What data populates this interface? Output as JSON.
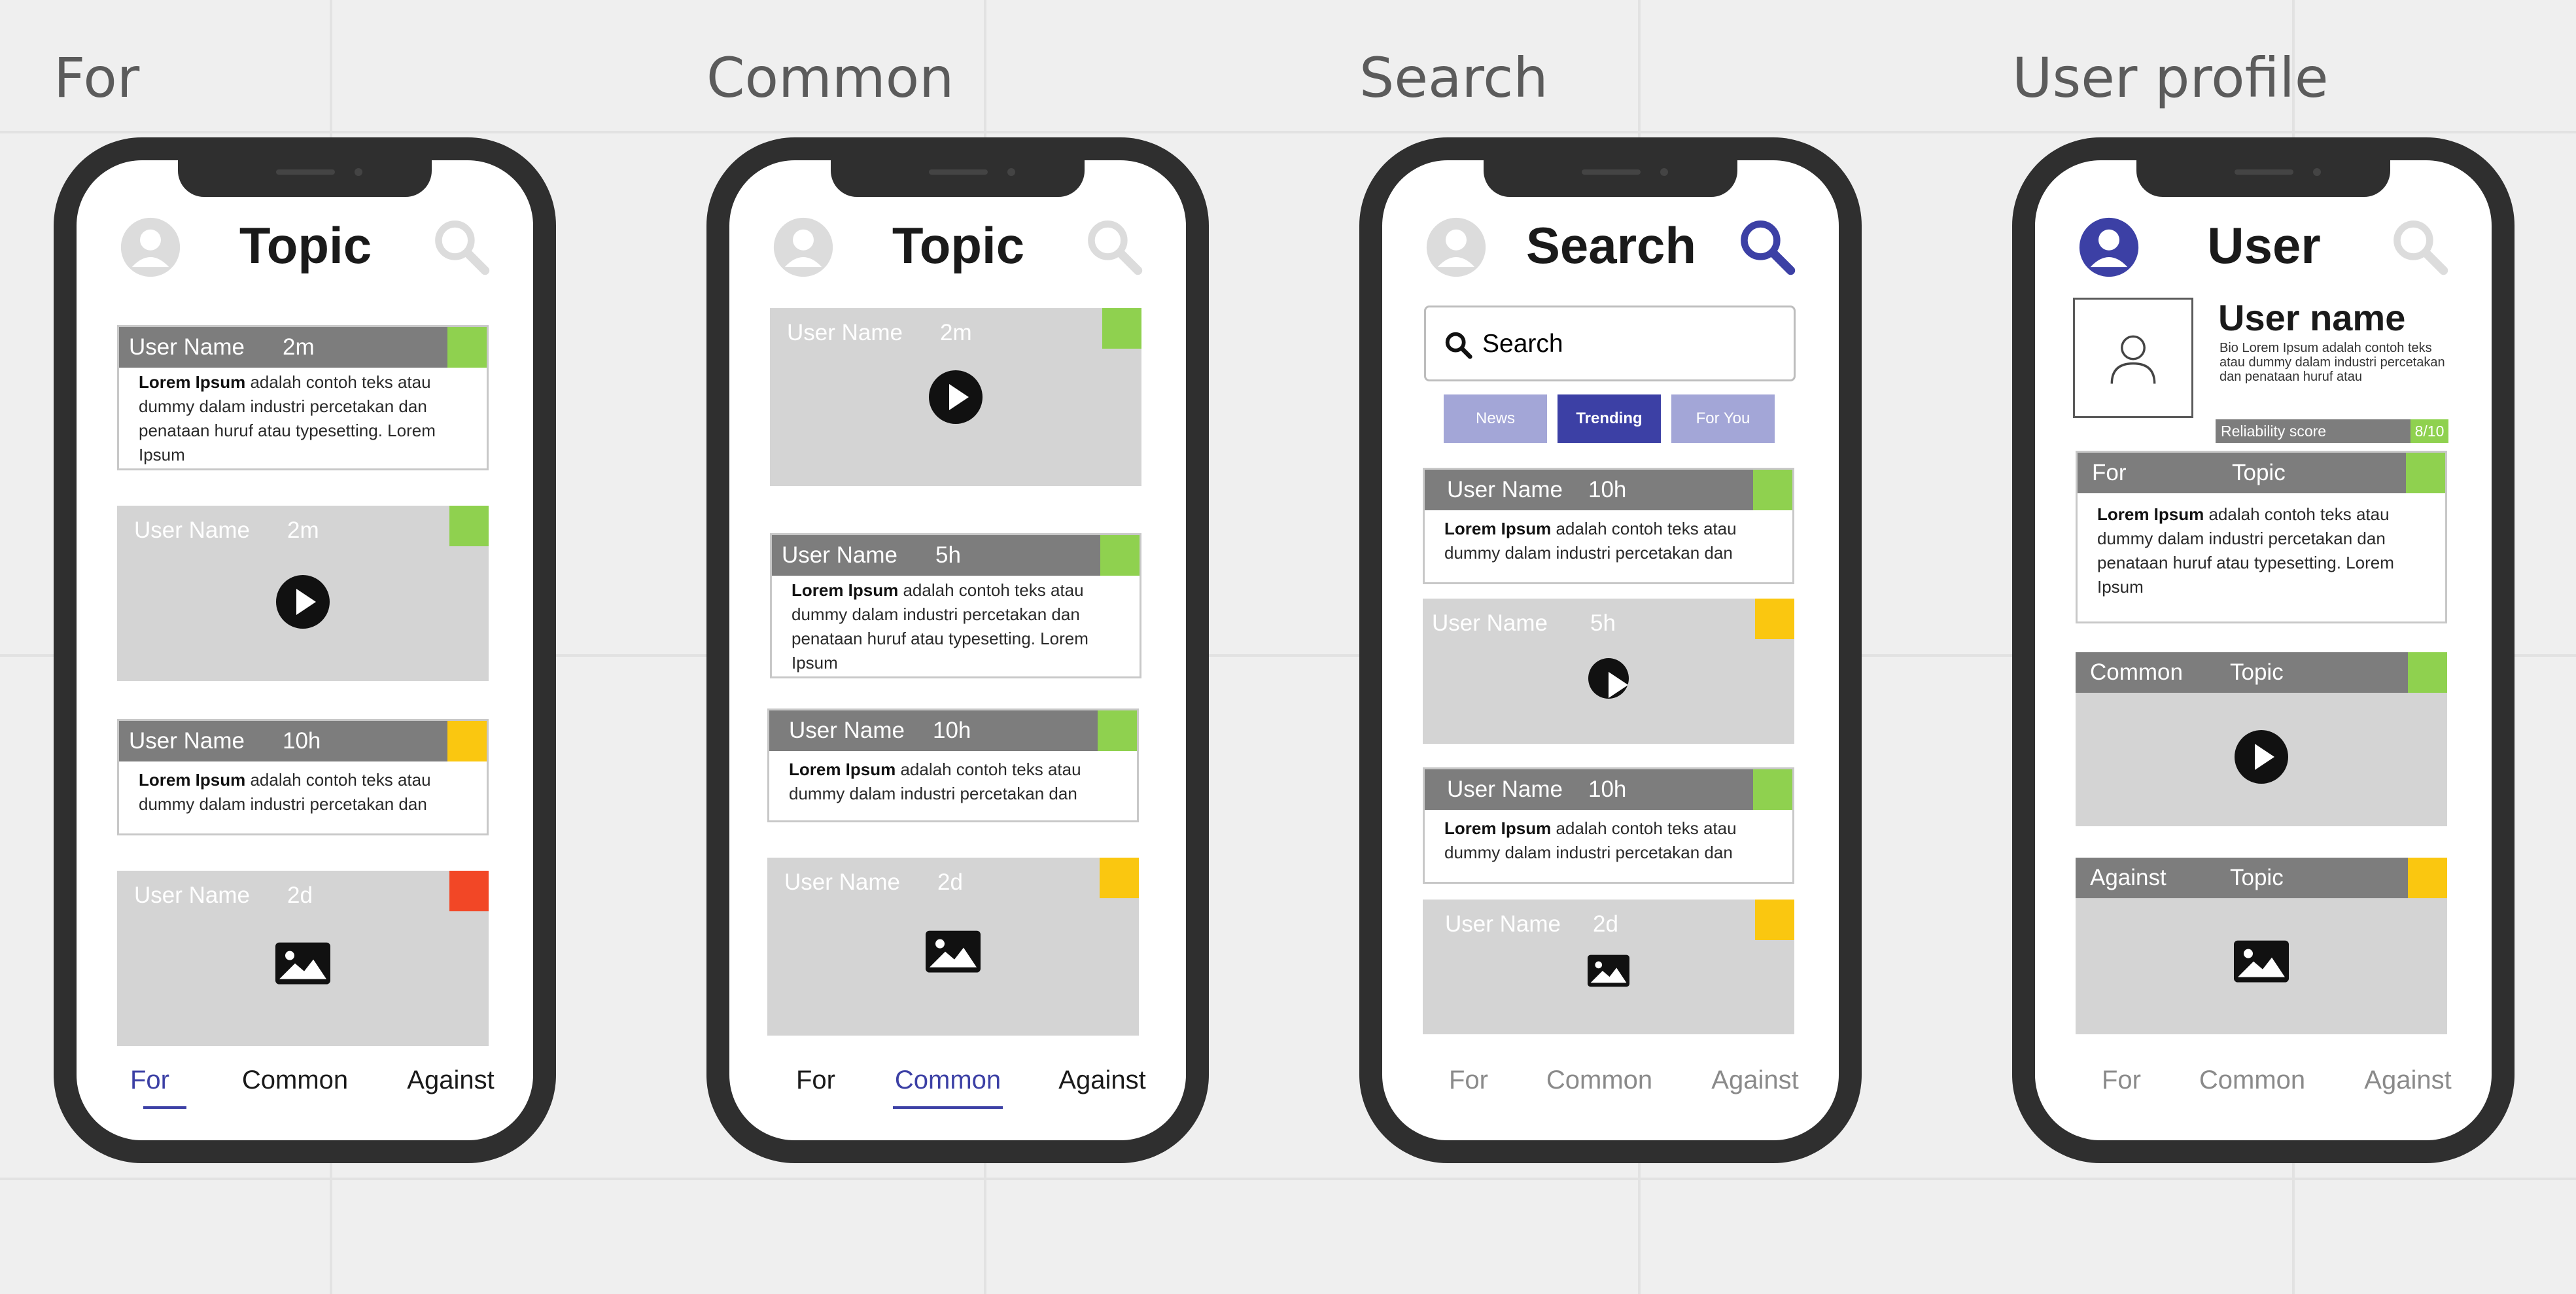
{
  "frames": [
    {
      "title": "For",
      "header": "Topic",
      "cards": [
        {
          "user": "User Name",
          "time": "2m",
          "body_bold": "Lorem Ipsum",
          "body": " adalah contoh teks atau dummy dalam industri percetakan dan penataan huruf atau typesetting. Lorem Ipsum",
          "flag_color": "#8fd14f"
        },
        {
          "user": "User Name",
          "time": "2m",
          "media": "play-icon",
          "flag_color": "#8fd14f"
        },
        {
          "user": "User Name",
          "time": "10h",
          "body_bold": "Lorem Ipsum",
          "body": " adalah contoh teks atau dummy dalam industri percetakan dan",
          "flag_color": "#fac710"
        },
        {
          "user": "User Name",
          "time": "2d",
          "media": "image-icon",
          "flag_color": "#f24726"
        }
      ],
      "tabs": [
        "For",
        "Common",
        "Against"
      ],
      "active_tab": "For"
    },
    {
      "title": "Common",
      "header": "Topic",
      "cards": [
        {
          "user": "User Name",
          "time": "2m",
          "media": "play-icon",
          "flag_color": "#8fd14f"
        },
        {
          "user": "User Name",
          "time": "5h",
          "body_bold": "Lorem Ipsum",
          "body": " adalah contoh teks atau dummy dalam industri percetakan dan penataan huruf atau typesetting. Lorem Ipsum",
          "flag_color": "#8fd14f"
        },
        {
          "user": "User Name",
          "time": "10h",
          "body_bold": "Lorem Ipsum",
          "body": " adalah contoh teks atau dummy dalam industri percetakan dan",
          "flag_color": "#8fd14f"
        },
        {
          "user": "User Name",
          "time": "2d",
          "media": "image-icon",
          "flag_color": "#fac710"
        }
      ],
      "tabs": [
        "For",
        "Common",
        "Against"
      ],
      "active_tab": "Common"
    },
    {
      "title": "Search",
      "header": "Search",
      "search_label": "Search",
      "filters": [
        "News",
        "Trending",
        "For You"
      ],
      "active_filter": "Trending",
      "cards": [
        {
          "user": "User Name",
          "time": "10h",
          "body_bold": "Lorem Ipsum",
          "body": " adalah contoh teks atau dummy dalam industri percetakan dan",
          "flag_color": "#8fd14f"
        },
        {
          "user": "User Name",
          "time": "5h",
          "media": "play-icon",
          "flag_color": "#fac710"
        },
        {
          "user": "User Name",
          "time": "10h",
          "body_bold": "Lorem Ipsum",
          "body": " adalah contoh teks atau dummy dalam industri percetakan dan",
          "flag_color": "#8fd14f"
        },
        {
          "user": "User Name",
          "time": "2d",
          "media": "image-icon",
          "flag_color": "#fac710"
        }
      ],
      "tabs": [
        "For",
        "Common",
        "Against"
      ]
    },
    {
      "title": "User profile",
      "header": "User",
      "profile": {
        "name": "User name",
        "bio": "Bio Lorem Ipsum adalah contoh teks atau dummy dalam industri percetakan dan penataan huruf atau",
        "reliability_label": "Reliability score",
        "reliability_value": "8/10"
      },
      "cards": [
        {
          "stance": "For",
          "topic": "Topic",
          "body_bold": "Lorem Ipsum",
          "body": " adalah contoh teks atau dummy dalam industri percetakan dan penataan huruf atau typesetting. Lorem Ipsum",
          "flag_color": "#8fd14f"
        },
        {
          "stance": "Common",
          "topic": "Topic",
          "media": "play-icon",
          "flag_color": "#8fd14f"
        },
        {
          "stance": "Against",
          "topic": "Topic",
          "media": "image-icon",
          "flag_color": "#fac710"
        }
      ],
      "tabs": [
        "For",
        "Common",
        "Against"
      ]
    }
  ],
  "colors": {
    "accent": "#3c40a5",
    "accent_light": "#a3a6d7",
    "card_bar": "#7d7d7d",
    "media_bg": "#d4d4d4",
    "green": "#8fd14f",
    "yellow": "#fac710",
    "red": "#f24726"
  }
}
